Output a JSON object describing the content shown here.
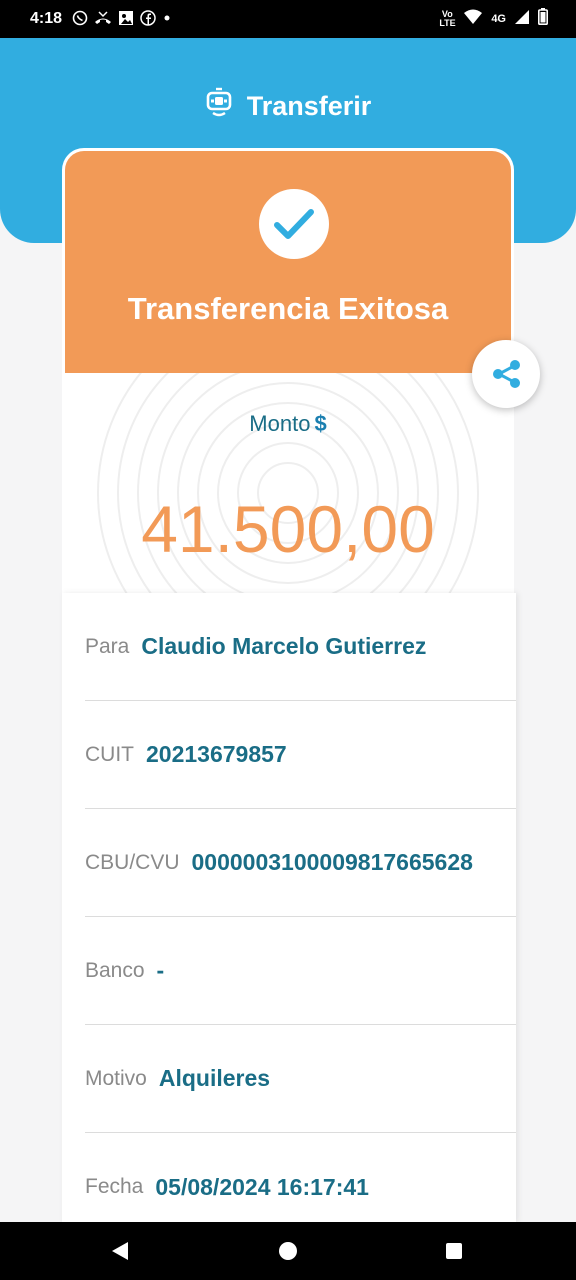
{
  "status_bar": {
    "time": "4:18",
    "network": "4G",
    "volte": "Vo LTE",
    "notification_icons": [
      "whatsapp-icon",
      "missed-call-icon",
      "gallery-icon",
      "facebook-icon",
      "dot-icon"
    ]
  },
  "header": {
    "title": "Transferir",
    "icon": "transfer-icon"
  },
  "result": {
    "title": "Transferencia Exitosa",
    "icon": "check-icon"
  },
  "amount": {
    "label": "Monto",
    "currency_symbol": "$",
    "value": "41.500,00"
  },
  "details": [
    {
      "label": "Para",
      "value": "Claudio Marcelo Gutierrez"
    },
    {
      "label": "CUIT",
      "value": "20213679857"
    },
    {
      "label": "CBU/CVU",
      "value": "0000003100009817665628"
    },
    {
      "label": "Banco",
      "value": "-"
    },
    {
      "label": "Motivo",
      "value": "Alquileres"
    },
    {
      "label": "Fecha",
      "value": "05/08/2024 16:17:41"
    }
  ],
  "colors": {
    "header_blue": "#31ade0",
    "success_orange": "#f29a57",
    "value_teal": "#1a6d86"
  }
}
